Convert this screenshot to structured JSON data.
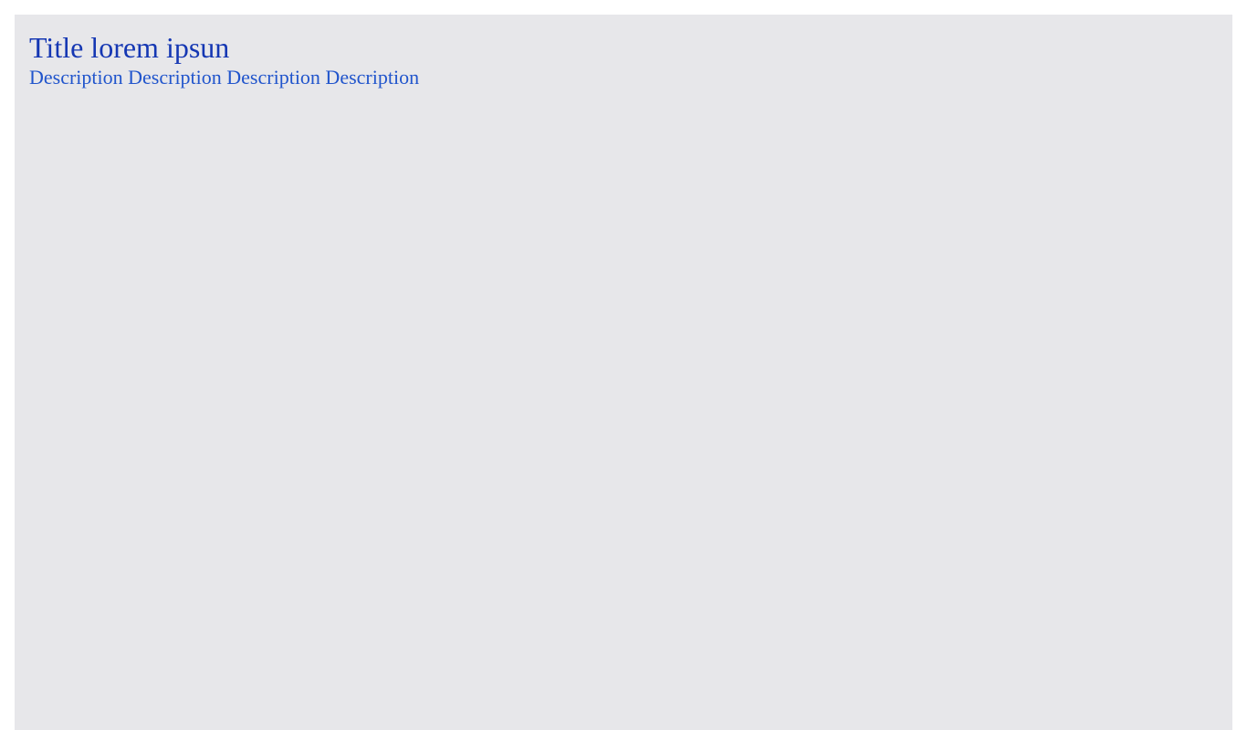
{
  "header": {
    "title": "Title lorem ipsun",
    "description": "Description Description Description Description"
  },
  "colors": {
    "background": "#e7e7ea",
    "title": "#1537b3",
    "description": "#2155cc"
  }
}
